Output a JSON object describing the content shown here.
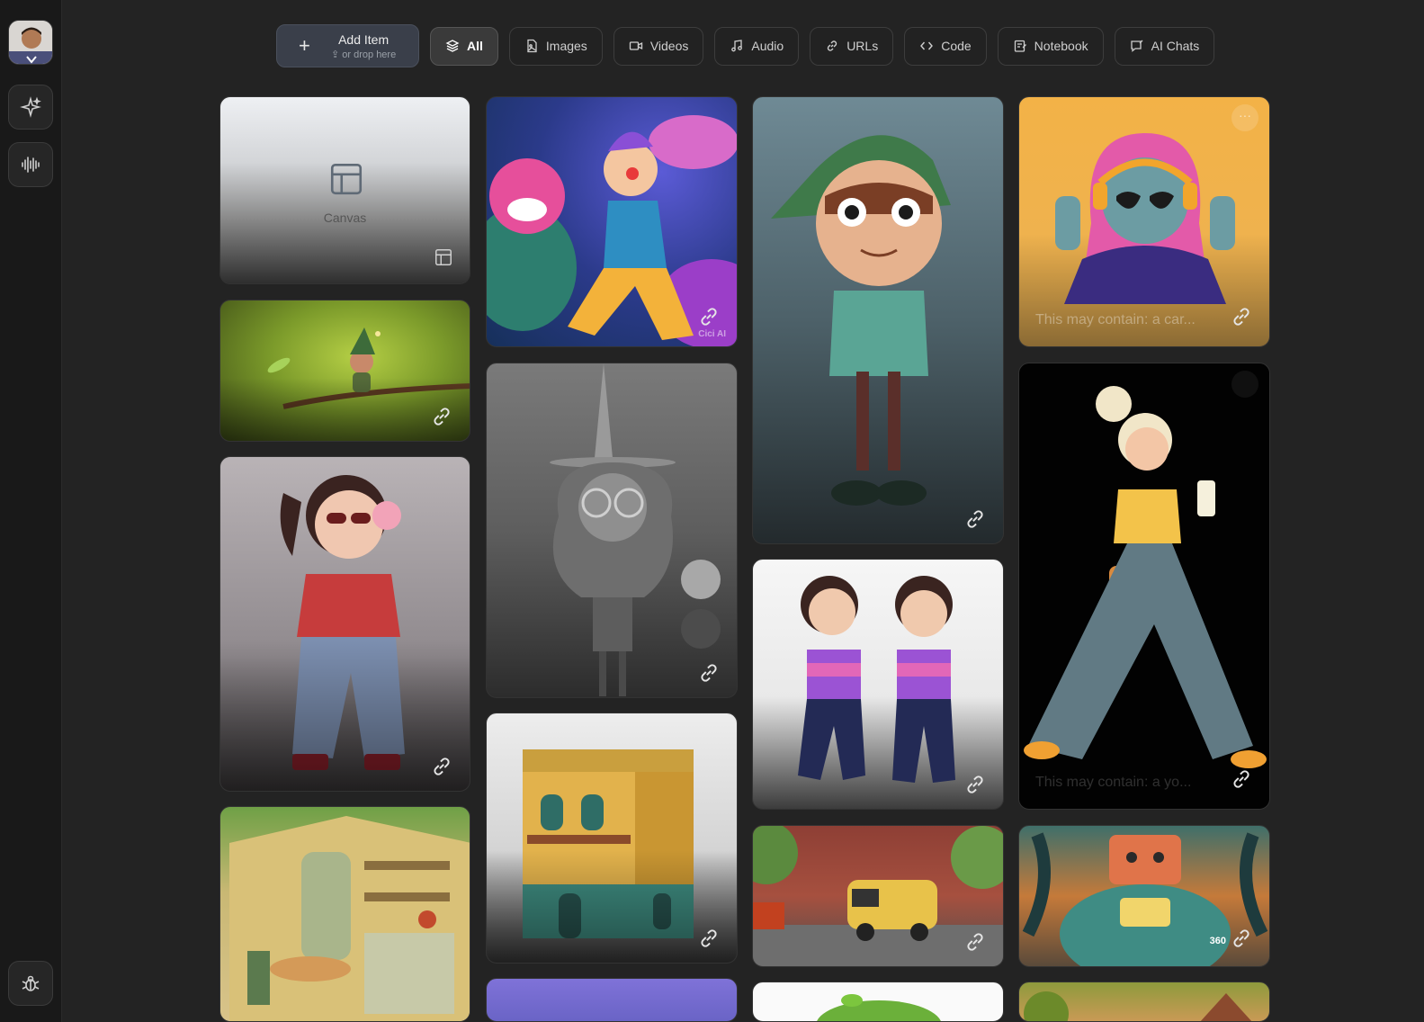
{
  "sidebar": {
    "avatar_alt": "User avatar",
    "buttons": [
      "sparkle-icon",
      "waveform-icon",
      "bug-icon"
    ]
  },
  "toolbar": {
    "add_item": {
      "label": "Add Item",
      "hint": "or drop here"
    },
    "filters": [
      {
        "label": "All",
        "icon": "layers-icon",
        "active": true
      },
      {
        "label": "Images",
        "icon": "image-file-icon",
        "active": false
      },
      {
        "label": "Videos",
        "icon": "video-icon",
        "active": false
      },
      {
        "label": "Audio",
        "icon": "music-note-icon",
        "active": false
      },
      {
        "label": "URLs",
        "icon": "link-icon",
        "active": false
      },
      {
        "label": "Code",
        "icon": "code-icon",
        "active": false
      },
      {
        "label": "Notebook",
        "icon": "notebook-icon",
        "active": false
      },
      {
        "label": "AI Chats",
        "icon": "chat-icon",
        "active": false
      }
    ]
  },
  "gallery": {
    "canvas_label": "Canvas",
    "card_captions": {
      "headphones_girl": "This may contain: a car...",
      "walking_girl": "This may contain: a yo..."
    },
    "badges": {
      "robot": "360",
      "clown_watermark": "Cici AI"
    }
  },
  "colors": {
    "background": "#232323",
    "sidebar": "#191919",
    "accent": "#3a3f4a"
  }
}
